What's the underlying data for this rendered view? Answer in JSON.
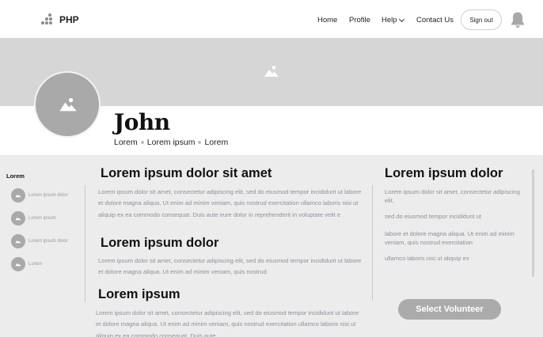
{
  "navbar": {
    "logo_text": "PHP",
    "links": [
      {
        "label": "Home"
      },
      {
        "label": "Profile"
      },
      {
        "label": "Help"
      },
      {
        "label": "Contact Us"
      }
    ],
    "signout_label": "Sign out",
    "bell_icon": "bell-icon"
  },
  "cover": {
    "icon": "image-placeholder-icon"
  },
  "profile": {
    "name": "John",
    "meta": [
      "Lorem",
      "Lorem ipsum",
      "Lorem"
    ]
  },
  "sidebar": {
    "title": "Lorem",
    "items": [
      {
        "label": "Lorem ipsum dolor"
      },
      {
        "label": "Lorem ipsum"
      },
      {
        "label": "Lorem ipsum dolor"
      },
      {
        "label": "Lorem"
      }
    ]
  },
  "main": {
    "sections": [
      {
        "heading": "Lorem ipsum dolor sit amet",
        "body": "Lorem ipsum dolor sit amet, consectetur adipiscing elit, sed do eiusmod tempor incididunt ut labore et dolore magna aliqua. Ut enim ad minim veniam, quis nostrud exercitation ullamco laboris nisi ut aliquip ex ea commodo consequat. Duis aute irure dolor in reprehenderit in voluptate velit e"
      },
      {
        "heading": "Lorem ipsum dolor",
        "body": "Lorem ipsum dolor sit amet, consectetur adipiscing elit, sed do eiusmod tempor incididunt ut labore et dolore magna aliqua. Ut enim ad minim veniam, quis nostrud"
      },
      {
        "heading": "Lorem ipsum",
        "body": "Lorem ipsum dolor sit amet, consectetur adipiscing elit, sed do eiusmod tempor incididunt ut labore et dolore magna aliqua. Ut enim ad minim veniam, quis nostrud exercitation ullamco laboris nisi ut aliquip ex ea commodo consequat. Duis aute"
      }
    ]
  },
  "right_panel": {
    "heading": "Lorem ipsum dolor",
    "paragraphs": [
      "Lorem ipsum dolor sit amet, consectetur adipiscing elit,",
      "sed do eiusmod tempor incididunt ut",
      "labore et dolore magna aliqua. Ut enim ad minim veniam, quis nostrud exercitation",
      "ullamco laboris nisi ut aliquip ex"
    ],
    "button_label": "Select Volunteer"
  },
  "colors": {
    "cover_bg": "#d6d6d6",
    "content_bg": "#ececec",
    "placeholder_gray": "#a9a9a9",
    "body_text": "#8f8f9a"
  }
}
